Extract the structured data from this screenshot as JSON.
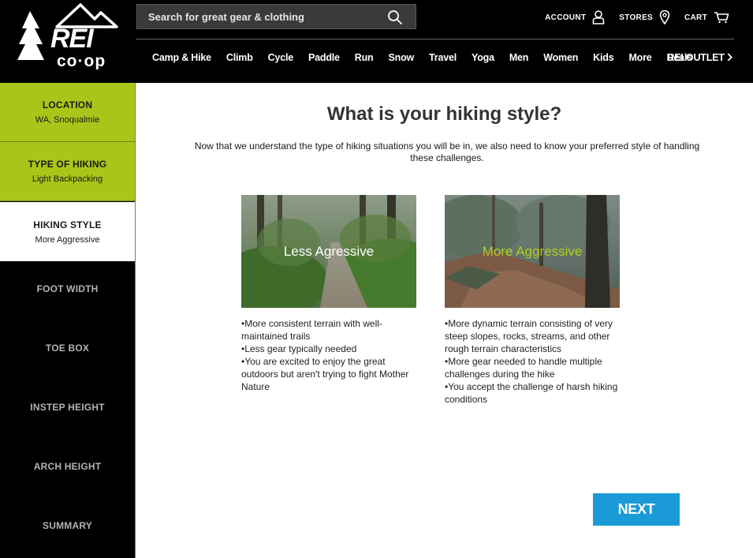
{
  "header": {
    "logo_text": "REI co-op",
    "search_placeholder": "Search for great gear & clothing",
    "account_label": "ACCOUNT",
    "stores_label": "STORES",
    "cart_label": "CART",
    "nav_items": [
      "Camp & Hike",
      "Climb",
      "Cycle",
      "Paddle",
      "Run",
      "Snow",
      "Travel",
      "Yoga",
      "Men",
      "Women",
      "Kids",
      "More",
      "Deals"
    ],
    "outlet_label": "REI OUTLET"
  },
  "sidebar": {
    "steps": [
      {
        "title": "LOCATION",
        "value": "WA, Snoqualmie",
        "state": "done"
      },
      {
        "title": "TYPE OF HIKING",
        "value": "Light Backpacking",
        "state": "done"
      },
      {
        "title": "HIKING STYLE",
        "value": "More Aggressive",
        "state": "active"
      },
      {
        "title": "FOOT WIDTH",
        "value": "",
        "state": "todo"
      },
      {
        "title": "TOE BOX",
        "value": "",
        "state": "todo"
      },
      {
        "title": "INSTEP HEIGHT",
        "value": "",
        "state": "todo"
      },
      {
        "title": "ARCH HEIGHT",
        "value": "",
        "state": "todo"
      },
      {
        "title": "SUMMARY",
        "value": "",
        "state": "todo"
      }
    ]
  },
  "main": {
    "title": "What is your hiking style?",
    "intro": "Now that we understand the type of hiking situations you will be in, we also need to know your preferred style of handling these challenges.",
    "options": [
      {
        "label": "Less Agressive",
        "bullets": [
          "More consistent terrain with well-maintained trails",
          "Less gear typically needed",
          "You are excited to enjoy the great outdoors but aren't trying to fight Mother Nature"
        ]
      },
      {
        "label": "More Aggressive",
        "bullets": [
          "More dynamic terrain consisting of very steep slopes, rocks, streams, and other rough terrain characteristics",
          "More gear needed to handle multiple challenges during the hike",
          "You accept the challenge of harsh hiking conditions"
        ]
      }
    ],
    "next_label": "NEXT"
  },
  "colors": {
    "header_bg": "#000000",
    "completed_step": "#a8c619",
    "selected_label": "#b4cf1d",
    "next_button": "#1a9ad6"
  },
  "icons": [
    "search-icon",
    "account-icon",
    "stores-pin-icon",
    "cart-icon",
    "chevron-right-icon"
  ]
}
